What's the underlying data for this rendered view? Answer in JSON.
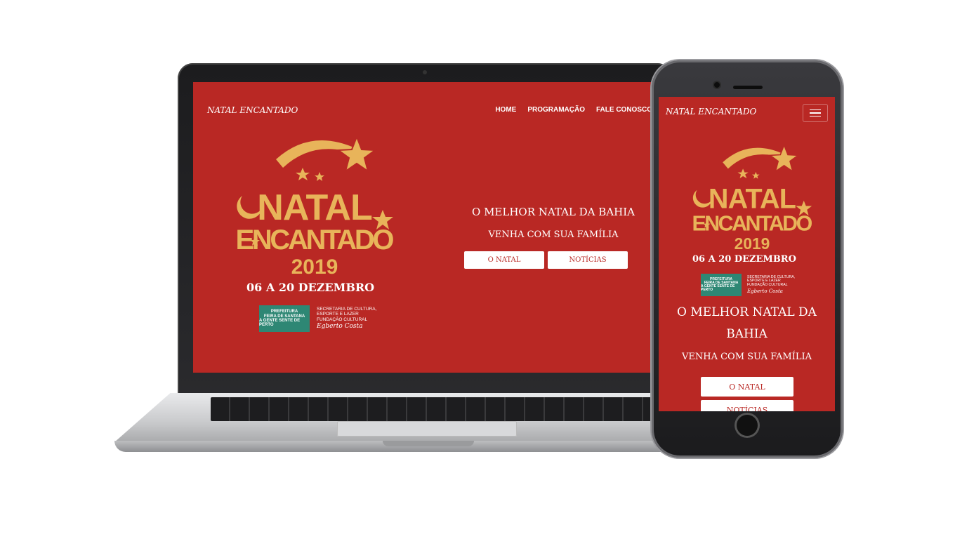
{
  "site": {
    "brand": "NATAL ENCANTADO",
    "nav": [
      "HOME",
      "PROGRAMAÇÃO",
      "FALE CONOSCO"
    ],
    "logo": {
      "line1": "NATAL",
      "line2": "ENCANTADO",
      "year": "2019",
      "gold_color": "#e8b45a",
      "background_color": "#b92824"
    },
    "dates": "06 A 20 DEZEMBRO",
    "partner": {
      "badge_top": "PREFEITURA",
      "badge_main": "FEIRA DE SANTANA",
      "badge_sub": "A GENTE SENTE DE PERTO",
      "line1": "SECRETARIA DE CULTURA,",
      "line2": "ESPORTE E LAZER",
      "line3": "FUNDAÇÃO CULTURAL",
      "signature": "Egberto Costa"
    },
    "headline": "O MELHOR NATAL DA BAHIA",
    "subheadline": "VENHA COM SUA FAMÍLIA",
    "buttons": [
      "O NATAL",
      "NOTÍCIAS"
    ]
  }
}
